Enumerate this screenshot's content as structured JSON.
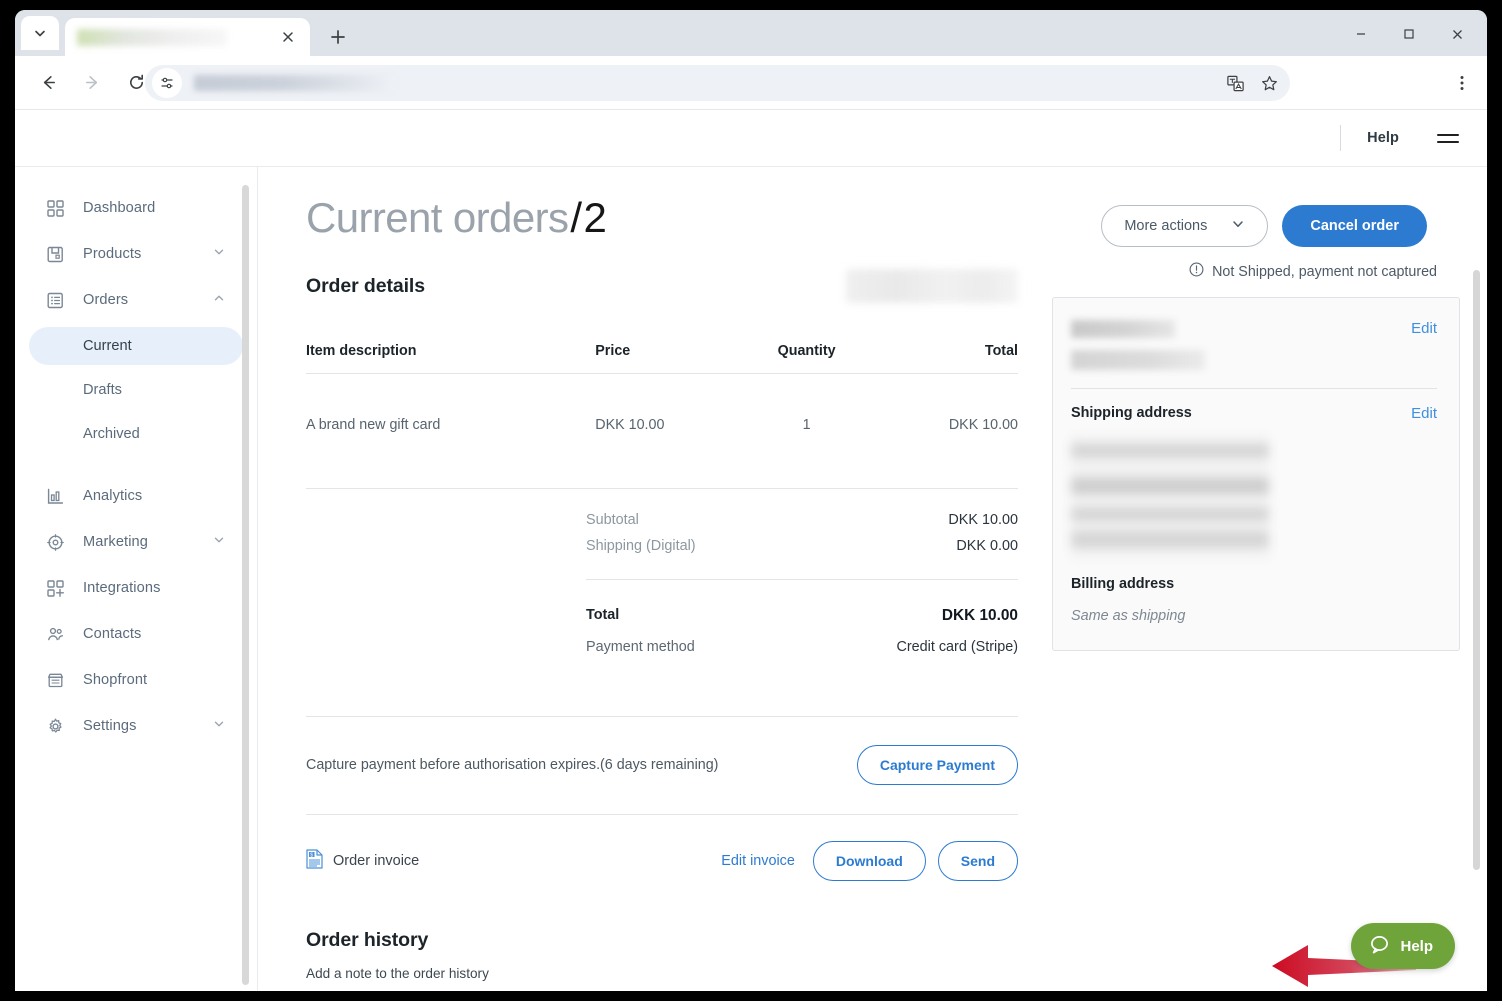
{
  "browser": {
    "tab_title_hidden": "",
    "url_hidden": "",
    "buttons": {
      "tab_list": "tab-list",
      "new_tab": "+",
      "close_tab": "×",
      "back": "←",
      "forward": "→",
      "reload": "⟳",
      "minimize": "−",
      "maximize": "□",
      "close": "×"
    }
  },
  "appbar": {
    "help_label": "Help"
  },
  "sidebar": {
    "items": [
      {
        "label": "Dashboard",
        "icon": "grid-icon",
        "expandable": false
      },
      {
        "label": "Products",
        "icon": "box-icon",
        "expandable": true,
        "chevron": "down"
      },
      {
        "label": "Orders",
        "icon": "list-icon",
        "expandable": true,
        "chevron": "up"
      }
    ],
    "sub_items": [
      {
        "label": "Current",
        "active": true
      },
      {
        "label": "Drafts",
        "active": false
      },
      {
        "label": "Archived",
        "active": false
      }
    ],
    "items_after": [
      {
        "label": "Analytics",
        "icon": "bar-chart-icon",
        "expandable": false
      },
      {
        "label": "Marketing",
        "icon": "target-icon",
        "expandable": true,
        "chevron": "down"
      },
      {
        "label": "Integrations",
        "icon": "grid-plus-icon",
        "expandable": false
      },
      {
        "label": "Contacts",
        "icon": "people-icon",
        "expandable": false
      },
      {
        "label": "Shopfront",
        "icon": "store-icon",
        "expandable": false
      },
      {
        "label": "Settings",
        "icon": "gear-icon",
        "expandable": true,
        "chevron": "down"
      }
    ]
  },
  "page": {
    "title_prefix": "Current orders",
    "title_separator": "/",
    "order_number": "2",
    "more_actions_label": "More actions",
    "cancel_order_label": "Cancel order",
    "status_text": "Not Shipped, payment not captured"
  },
  "order_details": {
    "section_title": "Order details",
    "columns": [
      "Item description",
      "Price",
      "Quantity",
      "Total"
    ],
    "rows": [
      {
        "description": "A brand new gift card",
        "price": "DKK 10.00",
        "quantity": "1",
        "total": "DKK 10.00"
      }
    ],
    "totals": [
      {
        "label": "Subtotal",
        "value": "DKK 10.00"
      },
      {
        "label": "Shipping (Digital)",
        "value": "DKK 0.00"
      }
    ],
    "grand_total": {
      "label": "Total",
      "value": "DKK 10.00"
    },
    "payment_method": {
      "label": "Payment method",
      "value": "Credit card (Stripe)"
    }
  },
  "capture": {
    "text": "Capture payment before authorisation expires.(6 days remaining)",
    "button_label": "Capture Payment"
  },
  "invoice": {
    "label": "Order invoice",
    "edit_label": "Edit invoice",
    "download_label": "Download",
    "send_label": "Send"
  },
  "history": {
    "title": "Order history",
    "note_prompt": "Add a note to the order history"
  },
  "address_card": {
    "edit_label_customer": "Edit",
    "shipping_label": "Shipping address",
    "edit_label_shipping": "Edit",
    "billing_label": "Billing address",
    "billing_value": "Same as shipping"
  },
  "help_widget": {
    "label": "Help"
  },
  "colors": {
    "primary_blue": "#2c7bd1",
    "link_blue": "#3d8fe0",
    "active_nav_bg": "#e7f0fa",
    "help_green": "#6fa43b",
    "arrow_red": "#cc0b22",
    "text_dark": "#1d2429",
    "text_muted": "#8d979f"
  }
}
